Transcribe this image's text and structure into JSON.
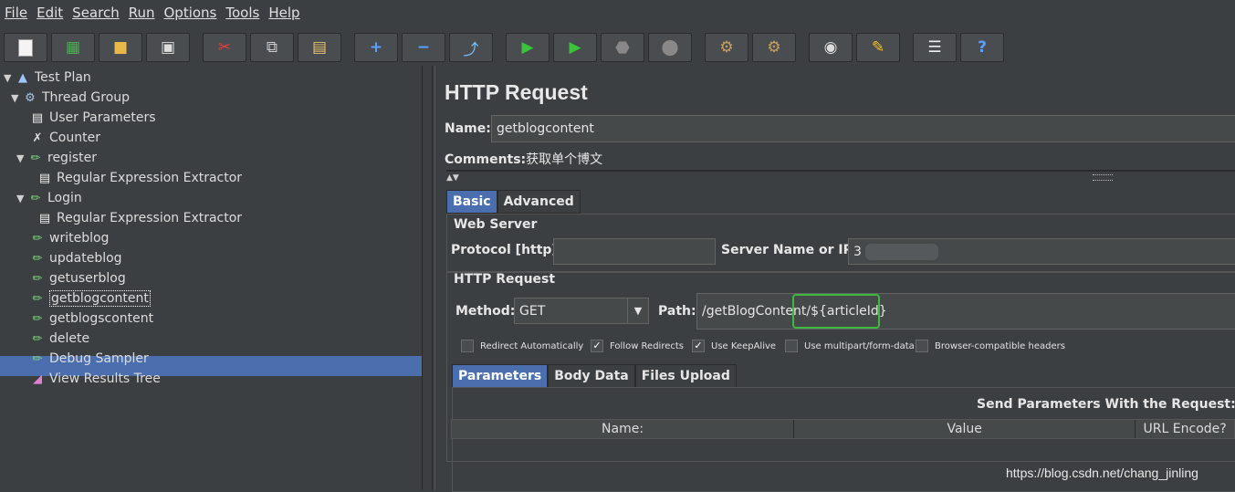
{
  "menu": [
    "File",
    "Edit",
    "Search",
    "Run",
    "Options",
    "Tools",
    "Help"
  ],
  "tree": [
    {
      "label": "Test Plan",
      "icon": "flask-icon"
    },
    {
      "label": "Thread Group",
      "icon": "gear-icon"
    },
    {
      "label": "User Parameters",
      "icon": "document-icon"
    },
    {
      "label": "Counter",
      "icon": "tools-icon"
    },
    {
      "label": "register",
      "icon": "pipette-icon"
    },
    {
      "label": "Regular Expression Extractor",
      "icon": "document-icon"
    },
    {
      "label": "Login",
      "icon": "pipette-icon"
    },
    {
      "label": "Regular Expression Extractor",
      "icon": "document-icon"
    },
    {
      "label": "writeblog",
      "icon": "pipette-icon"
    },
    {
      "label": "updateblog",
      "icon": "pipette-icon"
    },
    {
      "label": "getuserblog",
      "icon": "pipette-icon"
    },
    {
      "label": "getblogcontent",
      "icon": "pipette-icon"
    },
    {
      "label": "getblogscontent",
      "icon": "pipette-icon"
    },
    {
      "label": "delete",
      "icon": "pipette-icon"
    },
    {
      "label": "Debug Sampler",
      "icon": "pipette-icon"
    },
    {
      "label": "View Results Tree",
      "icon": "chart-icon"
    }
  ],
  "panel": {
    "title": "HTTP Request",
    "name_label": "Name:",
    "name_value": "getblogcontent",
    "comments_label": "Comments:",
    "comments_value": "获取单个博文",
    "tabs": [
      "Basic",
      "Advanced"
    ],
    "web_server_title": "Web Server",
    "protocol_label": "Protocol [http]:",
    "protocol_value": "",
    "server_label": "Server Name or IP:",
    "server_value": "3",
    "http_request_title": "HTTP Request",
    "method_label": "Method:",
    "method_value": "GET",
    "path_label": "Path:",
    "path_value_prefix": "/getBlogContent/",
    "path_value_highlight": "${articleId}",
    "checkboxes": [
      {
        "label": "Redirect Automatically",
        "checked": false
      },
      {
        "label": "Follow Redirects",
        "checked": true
      },
      {
        "label": "Use KeepAlive",
        "checked": true
      },
      {
        "label": "Use multipart/form-data",
        "checked": false
      },
      {
        "label": "Browser-compatible headers",
        "checked": false
      }
    ],
    "param_tabs": [
      "Parameters",
      "Body Data",
      "Files Upload"
    ],
    "send_params_label": "Send Parameters With the Request:",
    "table_headers": [
      "Name:",
      "Value",
      "URL Encode?"
    ]
  },
  "watermark": "https://blog.csdn.net/chang_jinling",
  "colors": {
    "selection": "#4b6eaf",
    "highlight_box": "#3fb83f"
  }
}
